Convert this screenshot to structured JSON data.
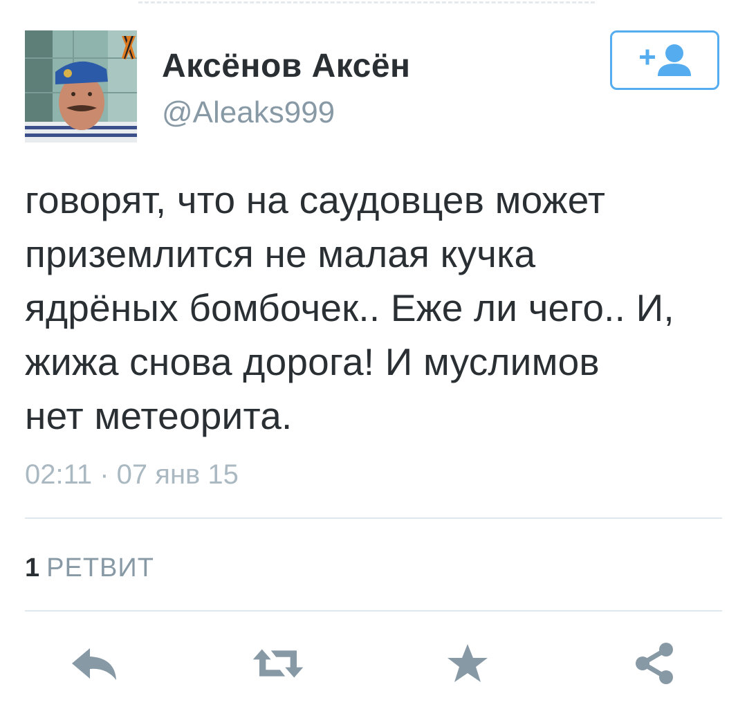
{
  "user": {
    "display_name": "Аксёнов Аксён",
    "screen_name": "@Aleaks999"
  },
  "follow_button": {
    "icon": "add-user-icon",
    "color": "#55acee"
  },
  "tweet": {
    "text": "говорят, что на саудовцев может\nприземлится не малая кучка\nядрёных бомбочек.. Еже ли чего..  И,\nжижа снова дорога! И муслимов\nнет метеорита.",
    "timestamp": "02:11 · 07 янв 15"
  },
  "stats": {
    "retweet_count": "1",
    "retweet_label": "РЕТВИТ"
  },
  "actions": [
    {
      "icon": "reply-icon"
    },
    {
      "icon": "retweet-icon"
    },
    {
      "icon": "favorite-star-icon"
    },
    {
      "icon": "share-icon"
    }
  ],
  "colors": {
    "text": "#292f33",
    "secondary": "#8899a6",
    "timestamp": "#aab8c2",
    "action_icons": "#8899a6",
    "divider": "#e1e8ed",
    "accent": "#55acee"
  }
}
